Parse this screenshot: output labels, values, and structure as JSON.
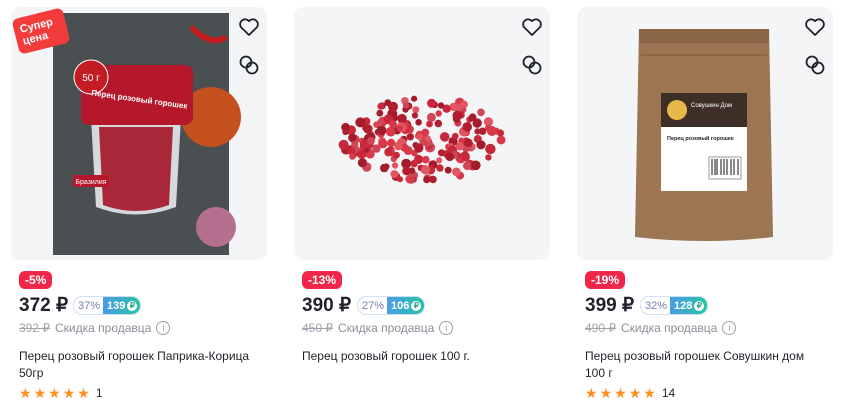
{
  "products": [
    {
      "super_badge": [
        "Супер",
        "цена"
      ],
      "discount": "-5%",
      "price": "372 ₽",
      "cashback_pct": "37%",
      "cashback_amount": "139",
      "old_price": "392 ₽",
      "seller_discount": "Скидка продавца",
      "title": "Перец розовый горошек Паприка-Корица 50гр",
      "rating_count": "1",
      "package_labels": {
        "weight": "50 г",
        "name": "Перец розовый горошек",
        "origin": "Бразилия"
      }
    },
    {
      "discount": "-13%",
      "price": "390 ₽",
      "cashback_pct": "27%",
      "cashback_amount": "106",
      "old_price": "450 ₽",
      "seller_discount": "Скидка продавца",
      "title": "Перец розовый горошек 100 г.",
      "rating_count": ""
    },
    {
      "discount": "-19%",
      "price": "399 ₽",
      "cashback_pct": "32%",
      "cashback_amount": "128",
      "old_price": "490 ₽",
      "seller_discount": "Скидка продавца",
      "title": "Перец розовый горошек Совушкин дом 100 г",
      "rating_count": "14",
      "package_labels": {
        "brand": "Совушкин Дом",
        "name": "Перец розовый горошек"
      }
    }
  ],
  "icons": {
    "favorite": "heart-icon",
    "compare": "compare-icon",
    "info": "info-icon",
    "star": "star-icon",
    "coin": "cashback-coin-icon"
  },
  "colors": {
    "discount": "#f0274a",
    "super_badge": "#f23b3b",
    "star": "#ff8f1f",
    "cashback_start": "#4b9be6",
    "cashback_end": "#26c4a3"
  }
}
